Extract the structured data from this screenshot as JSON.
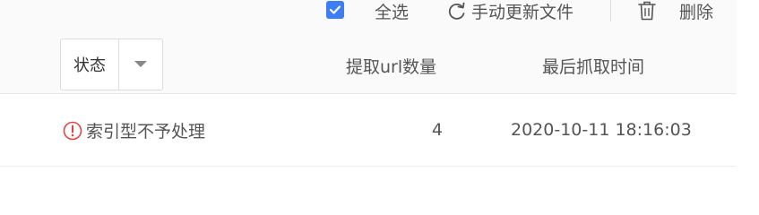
{
  "toolbar": {
    "select_all_checked": true,
    "select_all_label": "全选",
    "refresh_label": "手动更新文件",
    "delete_label": "删除"
  },
  "table": {
    "status_filter_label": "状态",
    "columns": {
      "url_count": "提取url数量",
      "last_crawl_time": "最后抓取时间"
    },
    "rows": [
      {
        "status": "索引型不予处理",
        "status_icon": "warning-circle-icon",
        "url_count": "4",
        "last_crawl_time": "2020-10-11 18:16:03"
      }
    ]
  },
  "colors": {
    "accent": "#3d7ef2",
    "warning": "#e04545"
  }
}
